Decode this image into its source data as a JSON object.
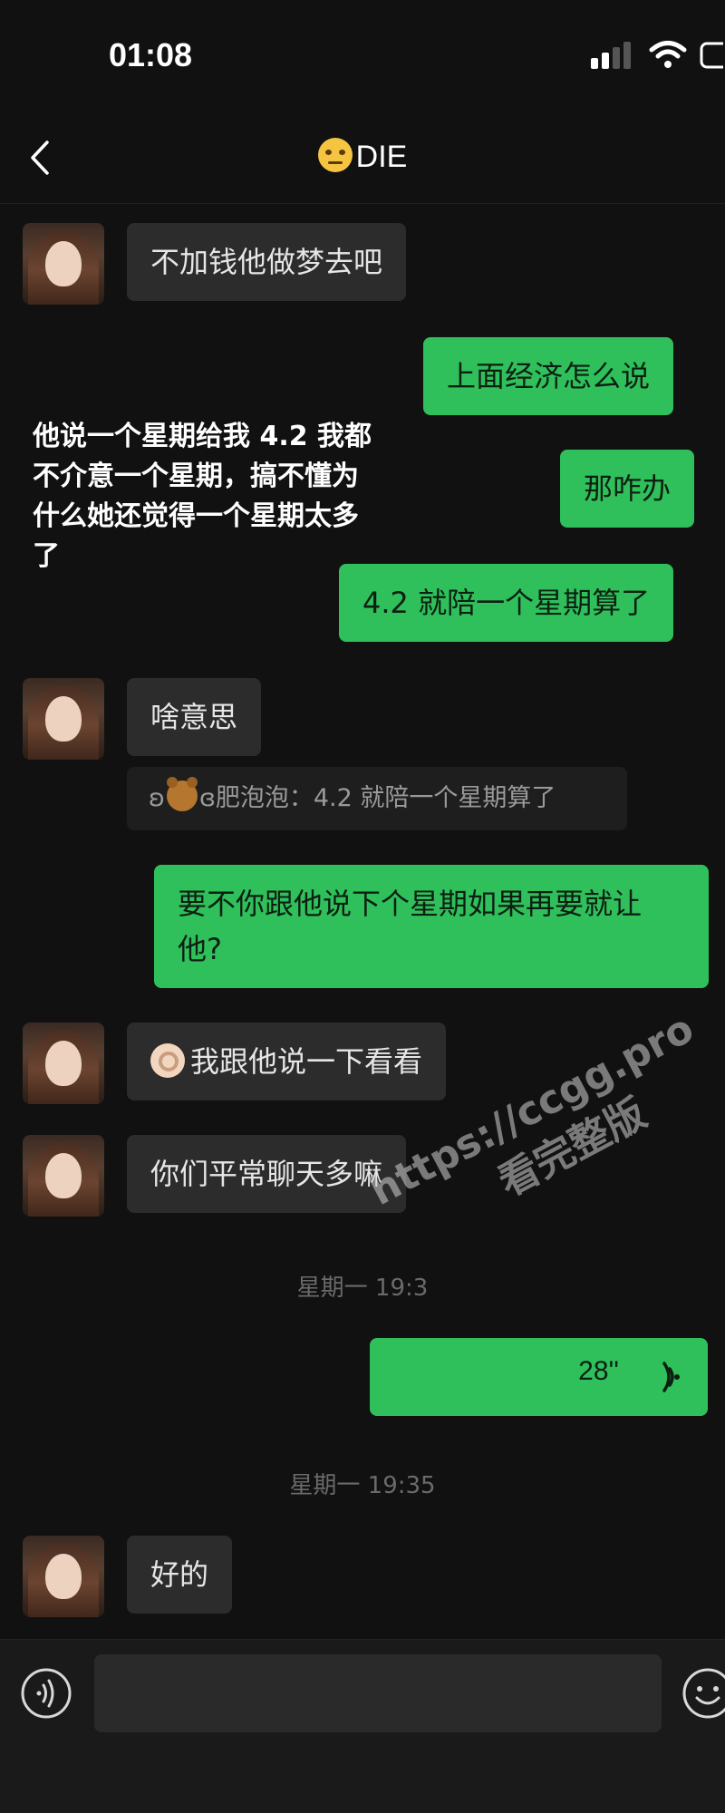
{
  "status_bar": {
    "time": "01:08"
  },
  "header": {
    "title": "DIE",
    "title_emoji": "face-with-raised-eyebrow"
  },
  "overlay_caption": "他说一个星期给我 4.2 我都不介意一个星期，搞不懂为什么她还觉得一个星期太多了",
  "messages": [
    {
      "side": "left",
      "text": "不加钱他做梦去吧"
    },
    {
      "side": "right",
      "text": "上面经济怎么说"
    },
    {
      "side": "right",
      "text": "那咋办"
    },
    {
      "side": "right",
      "text": "4.2 就陪一个星期算了"
    },
    {
      "side": "left",
      "text": "啥意思"
    },
    {
      "side": "right",
      "text": "要不你跟他说下个星期如果再要就让他?"
    },
    {
      "side": "left",
      "text": "我跟他说一下看看"
    },
    {
      "side": "left",
      "text": "你们平常聊天多嘛"
    },
    {
      "side": "left",
      "text": "好的"
    }
  ],
  "quote": {
    "prefix": "ʚ",
    "suffix": "ɞ",
    "sender": "肥泡泡：",
    "text": "4.2 就陪一个星期算了"
  },
  "timestamps": {
    "first": "星期一 19:3",
    "second": "星期一 19:35"
  },
  "voice_message": {
    "duration": "28''"
  },
  "watermark": {
    "line1": "https://ccgg.pro",
    "line2": "看完整版"
  },
  "input": {
    "value": "",
    "placeholder": ""
  },
  "colors": {
    "background": "#111111",
    "sent_bubble": "#2fc05b",
    "received_bubble": "#2c2c2c"
  }
}
